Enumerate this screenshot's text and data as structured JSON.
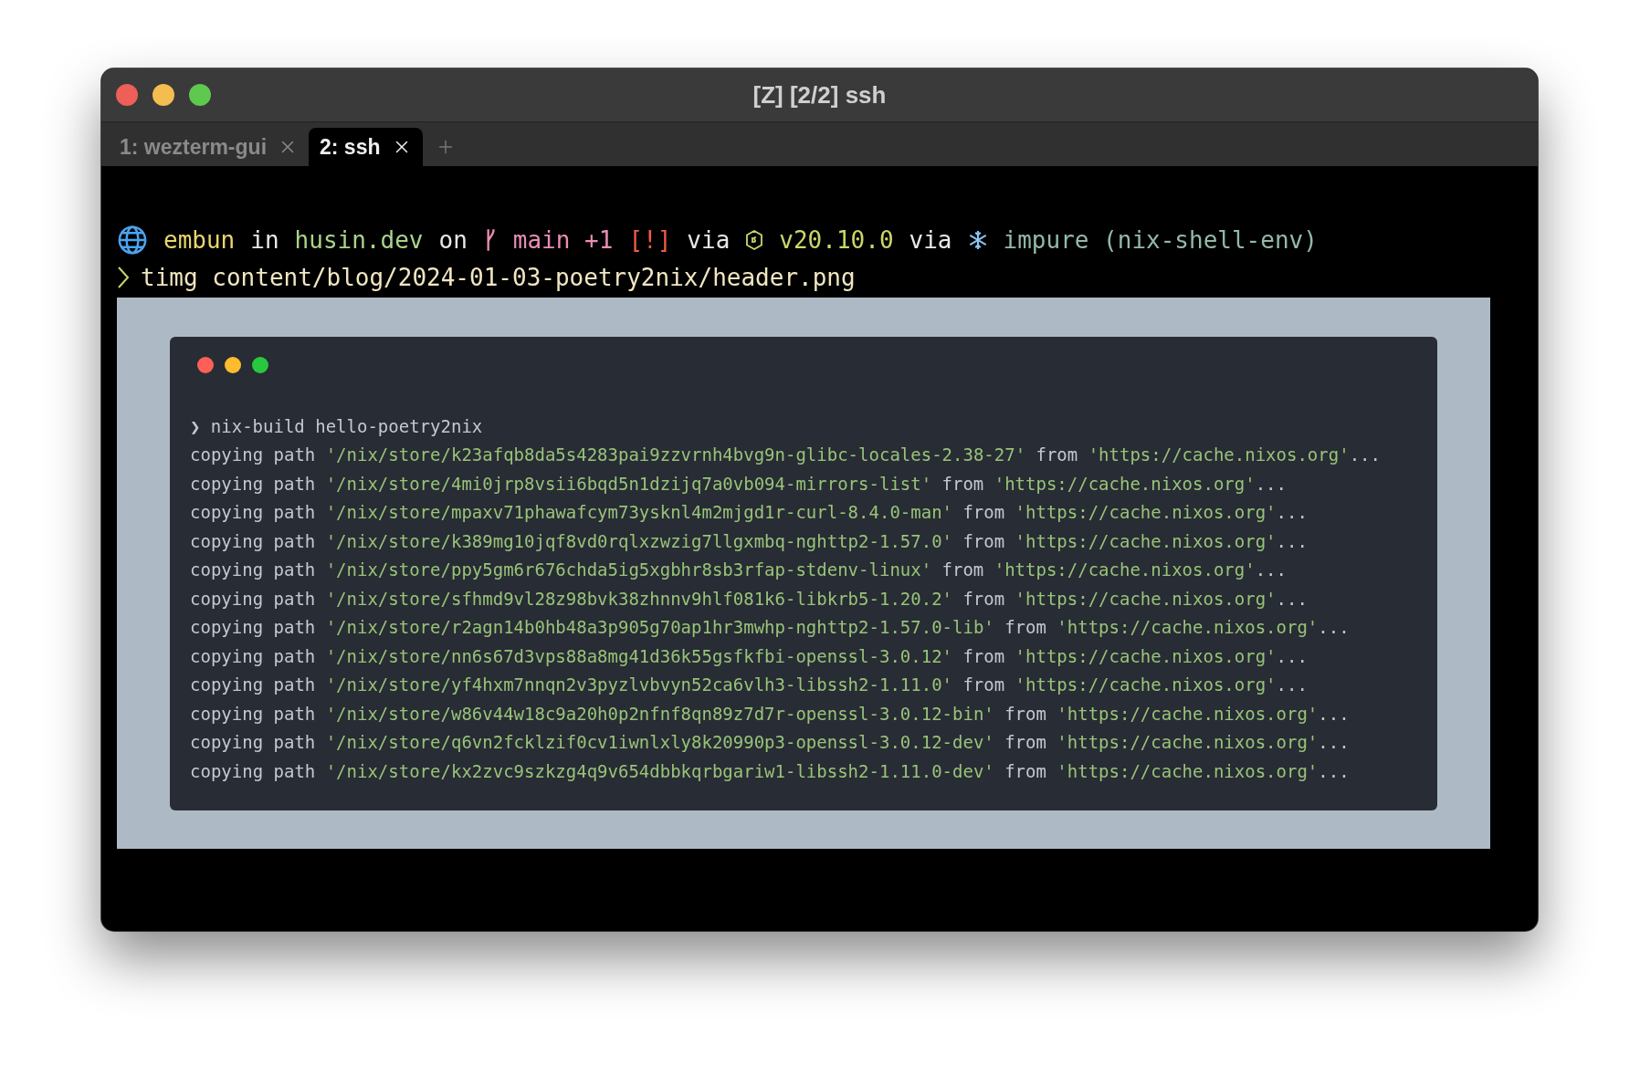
{
  "window": {
    "title": "[Z] [2/2] ssh"
  },
  "tabs": [
    {
      "label": "1: wezterm-gui",
      "selected": false
    },
    {
      "label": "2: ssh",
      "selected": true
    }
  ],
  "prompt": [
    {
      "kind": "globe"
    },
    {
      "kind": "user",
      "text": "embun"
    },
    {
      "kind": "plain",
      "text": "in"
    },
    {
      "kind": "host",
      "text": "husin.dev"
    },
    {
      "kind": "plain",
      "text": "on"
    },
    {
      "kind": "branch-icon"
    },
    {
      "kind": "branch",
      "text": "main +1"
    },
    {
      "kind": "status",
      "text": "[!]"
    },
    {
      "kind": "plain",
      "text": "via"
    },
    {
      "kind": "node-icon"
    },
    {
      "kind": "version",
      "text": "v20.10.0"
    },
    {
      "kind": "plain",
      "text": "via"
    },
    {
      "kind": "snowflake"
    },
    {
      "kind": "env",
      "text": "impure (nix-shell-env)"
    }
  ],
  "command": "timg content/blog/2024-01-03-poetry2nix/header.png",
  "image": {
    "command_prompt": "❯",
    "command": "nix-build hello-poetry2nix",
    "lines": [
      {
        "verb": "copying path",
        "path": "'/nix/store/k23afqb8da5s4283pai9zzvrnh4bvg9n-glibc-locales-2.38-27'",
        "from": "from",
        "source": "'https://cache.nixos.org'",
        "tail": "..."
      },
      {
        "verb": "copying path",
        "path": "'/nix/store/4mi0jrp8vsii6bqd5n1dzijq7a0vb094-mirrors-list'",
        "from": "from",
        "source": "'https://cache.nixos.org'",
        "tail": "..."
      },
      {
        "verb": "copying path",
        "path": "'/nix/store/mpaxv71phawafcym73ysknl4m2mjgd1r-curl-8.4.0-man'",
        "from": "from",
        "source": "'https://cache.nixos.org'",
        "tail": "..."
      },
      {
        "verb": "copying path",
        "path": "'/nix/store/k389mg10jqf8vd0rqlxzwzig7llgxmbq-nghttp2-1.57.0'",
        "from": "from",
        "source": "'https://cache.nixos.org'",
        "tail": "..."
      },
      {
        "verb": "copying path",
        "path": "'/nix/store/ppy5gm6r676chda5ig5xgbhr8sb3rfap-stdenv-linux'",
        "from": "from",
        "source": "'https://cache.nixos.org'",
        "tail": "..."
      },
      {
        "verb": "copying path",
        "path": "'/nix/store/sfhmd9vl28z98bvk38zhnnv9hlf081k6-libkrb5-1.20.2'",
        "from": "from",
        "source": "'https://cache.nixos.org'",
        "tail": "..."
      },
      {
        "verb": "copying path",
        "path": "'/nix/store/r2agn14b0hb48a3p905g70ap1hr3mwhp-nghttp2-1.57.0-lib'",
        "from": "from",
        "source": "'https://cache.nixos.org'",
        "tail": "..."
      },
      {
        "verb": "copying path",
        "path": "'/nix/store/nn6s67d3vps88a8mg41d36k55gsfkfbi-openssl-3.0.12'",
        "from": "from",
        "source": "'https://cache.nixos.org'",
        "tail": "..."
      },
      {
        "verb": "copying path",
        "path": "'/nix/store/yf4hxm7nnqn2v3pyzlvbvyn52ca6vlh3-libssh2-1.11.0'",
        "from": "from",
        "source": "'https://cache.nixos.org'",
        "tail": "..."
      },
      {
        "verb": "copying path",
        "path": "'/nix/store/w86v44w18c9a20h0p2nfnf8qn89z7d7r-openssl-3.0.12-bin'",
        "from": "from",
        "source": "'https://cache.nixos.org'",
        "tail": "..."
      },
      {
        "verb": "copying path",
        "path": "'/nix/store/q6vn2fcklzif0cv1iwnlxly8k20990p3-openssl-3.0.12-dev'",
        "from": "from",
        "source": "'https://cache.nixos.org'",
        "tail": "..."
      },
      {
        "verb": "copying path",
        "path": "'/nix/store/kx2zvc9szkzg4q9v654dbbkqrbgariw1-libssh2-1.11.0-dev'",
        "from": "from",
        "source": "'https://cache.nixos.org'",
        "tail": "..."
      }
    ]
  }
}
